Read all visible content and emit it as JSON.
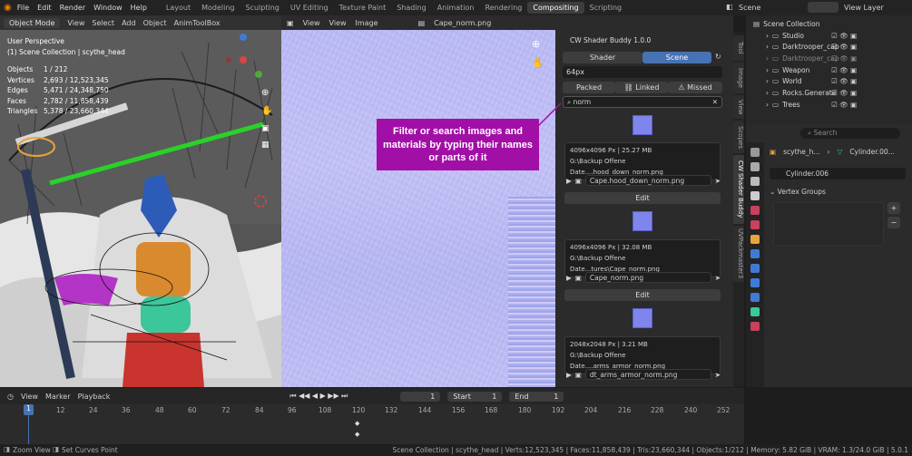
{
  "topbar": {
    "menus": [
      "File",
      "Edit",
      "Render",
      "Window",
      "Help"
    ],
    "workspaces": [
      "Layout",
      "Modeling",
      "Sculpting",
      "UV Editing",
      "Texture Paint",
      "Shading",
      "Animation",
      "Rendering",
      "Compositing",
      "Scripting"
    ],
    "active_workspace": "Compositing",
    "scene": "Scene",
    "view_layer": "View Layer"
  },
  "viewport": {
    "mode": "Object Mode",
    "menus": [
      "View",
      "Select",
      "Add",
      "Object",
      "AnimToolBox"
    ],
    "title": "User Perspective",
    "collection": "(1) Scene Collection | scythe_head",
    "stats": [
      {
        "k": "Objects",
        "v": "1 / 212"
      },
      {
        "k": "Vertices",
        "v": "2,693 / 12,523,345"
      },
      {
        "k": "Edges",
        "v": "5,471 / 24,348,750"
      },
      {
        "k": "Faces",
        "v": "2,782 / 11,858,439"
      },
      {
        "k": "Triangles",
        "v": "5,378 / 23,660,344"
      }
    ]
  },
  "image_editor": {
    "menus": [
      "View",
      "View",
      "Image"
    ],
    "image_name": "Cape_norm.png"
  },
  "panel": {
    "title": "CW Shader Buddy 1.0.0",
    "tab_shader": "Shader",
    "tab_scene": "Scene",
    "size": "64px",
    "filter_packed": "Packed",
    "filter_linked": "Linked",
    "filter_missed": "Missed",
    "search_value": "norm",
    "edit_label": "Edit",
    "items": [
      {
        "info": "4096x4096 Px | 25.27 MB",
        "path": "G:\\Backup Offene Date....hood_down_norm.png",
        "name": "Cape.hood_down_norm.png"
      },
      {
        "info": "4096x4096 Px | 32.08 MB",
        "path": "G:\\Backup Offene Date...tures\\Cape_norm.png",
        "name": "Cape_norm.png"
      },
      {
        "info": "2048x2048 Px | 3.21 MB",
        "path": "G:\\Backup Offene Date....arms_armor_norm.png",
        "name": "dt_arms_armor_norm.png"
      }
    ]
  },
  "tooltip": "Filter or search images and materials by typing their names or parts of it",
  "side_tabs": [
    "Tool",
    "Image",
    "View",
    "Scopes",
    "CW Shader Buddy",
    "UVPackmaster3"
  ],
  "outliner": {
    "root": "Scene Collection",
    "items": [
      "Studio",
      "Darktrooper_cap",
      "Darktrooper_cap",
      "Weapon",
      "World",
      "Rocks.Generate",
      "Trees"
    ]
  },
  "properties": {
    "search_placeholder": "Search",
    "object": "scythe_h...",
    "data": "Cylinder.00...",
    "mesh": "Cylinder.006",
    "section": "Vertex Groups"
  },
  "timeline": {
    "menus": [
      "View",
      "Marker",
      "Playback"
    ],
    "current_frame": "1",
    "start_label": "Start",
    "start": "1",
    "end_label": "End",
    "end": "1",
    "ticks": [
      "1",
      "12",
      "24",
      "36",
      "48",
      "60",
      "72",
      "84",
      "96",
      "108",
      "120",
      "132",
      "144",
      "156",
      "168",
      "180",
      "192",
      "204",
      "216",
      "228",
      "240",
      "252"
    ]
  },
  "status": {
    "left1": "Zoom View",
    "left2": "Set Curves Point",
    "right": "Scene Collection | scythe_head | Verts:12,523,345 | Faces:11,858,439 | Tris:23,660,344 | Objects:1/212 | Memory: 5.82 GiB | VRAM: 1.3/24.0 GiB | 5.0.1"
  },
  "colors": {
    "accent": "#4772b3",
    "tooltip": "#a20fa6",
    "active_frame": "#4772b3"
  }
}
